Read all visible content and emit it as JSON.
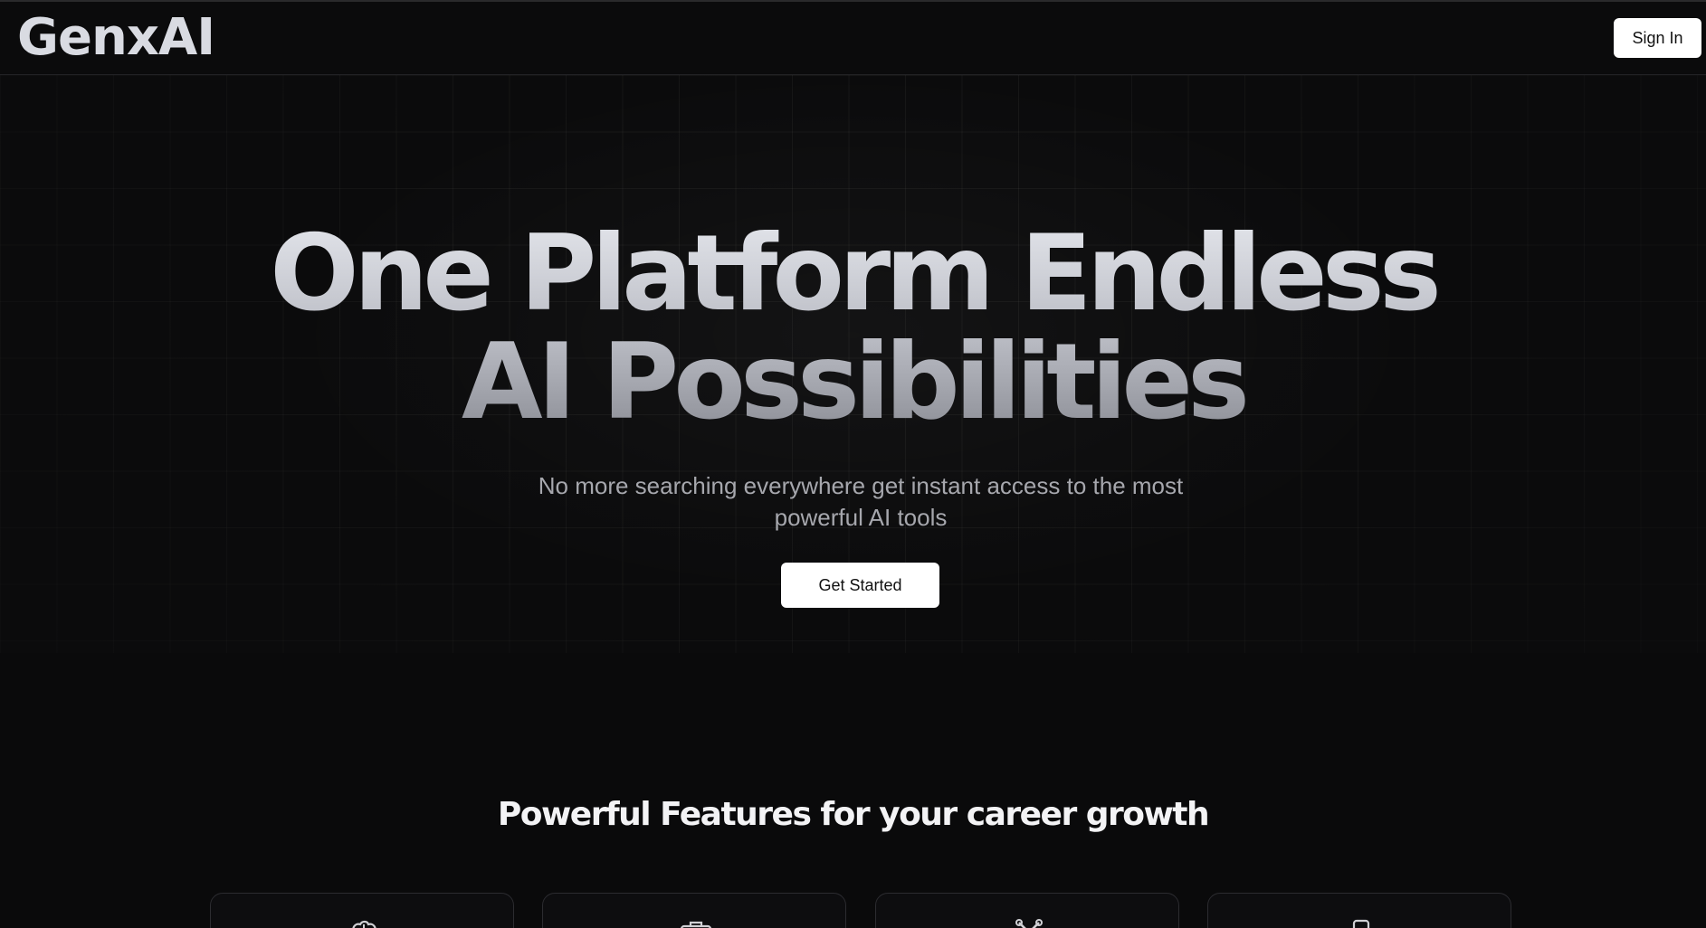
{
  "header": {
    "logo": "GenxAI",
    "signin_label": "Sign In"
  },
  "hero": {
    "title_line1": "One Platform Endless",
    "title_line2": "AI Possibilities",
    "subtitle_line1": "No more searching everywhere get instant access to the most",
    "subtitle_line2": "powerful AI tools",
    "cta_label": "Get Started"
  },
  "features": {
    "title": "Powerful Features for your career growth",
    "cards": [
      {
        "icon": "brain-icon"
      },
      {
        "icon": "briefcase-icon"
      },
      {
        "icon": "tools-icon"
      },
      {
        "icon": "phone-icon"
      }
    ]
  },
  "colors": {
    "background": "#0a0a0b",
    "button_bg": "#ffffff",
    "button_text": "#111111",
    "title_gradient_top": "#e2e4ea",
    "title_gradient_bottom": "#8c8e96",
    "subtitle": "#a6a7ad"
  }
}
